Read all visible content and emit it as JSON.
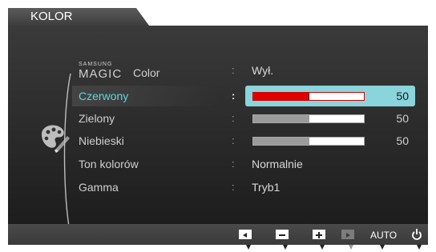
{
  "title": "KOLOR",
  "menu": [
    {
      "id": "magic",
      "brand_top": "SAMSUNG",
      "brand_main": "MAGIC",
      "label": "Color",
      "value": "Wył."
    },
    {
      "id": "red",
      "label": "Czerwony",
      "value": 50,
      "level": 0.5,
      "selected": true
    },
    {
      "id": "green",
      "label": "Zielony",
      "value": 50,
      "level": 0.5
    },
    {
      "id": "blue",
      "label": "Niebieski",
      "value": 50,
      "level": 0.5
    },
    {
      "id": "tone",
      "label": "Ton kolorów",
      "value": "Normalnie"
    },
    {
      "id": "gamma",
      "label": "Gamma",
      "value": "Tryb1"
    }
  ],
  "colon": ":",
  "footer": {
    "auto_label": "AUTO"
  },
  "colors": {
    "selection": "#8ad4dc",
    "selected_label": "#5fd6e3",
    "red_fill": "#e00000",
    "bar_fill": "#9b9b9b",
    "panel_dark": "#1d1d1d"
  },
  "icons": {
    "category": "palette-icon",
    "footer": [
      "left-arrow-icon",
      "minus-icon",
      "plus-icon",
      "enter-icon",
      "auto-button",
      "power-icon"
    ]
  }
}
